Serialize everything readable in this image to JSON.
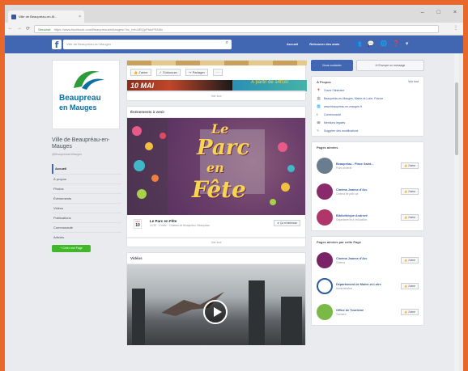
{
  "browser": {
    "tab_title": "Ville de Beaupréau-en-M...",
    "tab_close": "×",
    "url_secure": "Sécurisé",
    "url": "https://www.facebook.com/BeaupreauenMauges/?hc_ref=ARQpPtdvFR4Mx",
    "nav": [
      "←",
      "→",
      "⟳"
    ],
    "window_controls": [
      "–",
      "□",
      "×"
    ],
    "menu": "⋮"
  },
  "fb": {
    "logo": "f",
    "search_placeholder": "Ville de Beaupréau-en-Mauges",
    "nav": [
      "Accueil",
      "Retrouver des amis"
    ],
    "icons": [
      "👥",
      "💬",
      "🌐",
      "❓",
      "▾"
    ]
  },
  "left": {
    "logo_line1": "Beaupreau",
    "logo_line2": "en Mauges",
    "page_title": "Ville de Beaupréau-en-Mauges",
    "handle": "@BeaupreauenMauges",
    "nav": [
      "Accueil",
      "À propos",
      "Photos",
      "Événements",
      "Vidéos",
      "Publications",
      "Communauté",
      "Articles"
    ],
    "create_page": "+ Créer une Page"
  },
  "center": {
    "actions": [
      "👍 J'aime",
      "✓ S'abonner",
      "↪ Partager",
      "···"
    ],
    "banner_text": "10 MAI",
    "banner2_text": "À partir de 14h30",
    "see_all": "Voir tout",
    "events_header": "Événements à venir",
    "event_image_title": [
      "Le",
      "Parc",
      "en",
      "Fête"
    ],
    "event": {
      "month": "MAI",
      "day": "10",
      "name": "Le Parc en Fête",
      "details": "14:30 · 1 invité · Château de Beaupréau, Beaupréau",
      "interest_label": "★ Ça m'intéresse"
    },
    "see_all_2": "Voir tout",
    "videos_header": "Vidéos"
  },
  "right": {
    "btn_send": "Nous contacter",
    "btn_message": "✉ Envoyer un message",
    "about_header": "À Propos",
    "about_more": "Voir tout",
    "about_rows": [
      {
        "icon": "📍",
        "text": "Ouvrir l'itinéraire"
      },
      {
        "icon": "🏛",
        "text": "Beaupréau-en-Mauges, Maine-et-Loire, France"
      },
      {
        "icon": "🌐",
        "text": "www.beaupreau-en-mauges.fr"
      },
      {
        "icon": "ℹ",
        "text": "Communauté"
      },
      {
        "icon": "☎",
        "text": "Mentions légales"
      },
      {
        "icon": "✎",
        "text": "Suggérer des modifications"
      }
    ],
    "liked_header": "Pages aimées",
    "liked_pages": [
      {
        "name": "Beaupréau - Place Saint...",
        "sub": "Point d'intérêt",
        "color": "#6a7d8f",
        "like": "👍 J'aime"
      },
      {
        "name": "Cinéma Jeanne d'Arc",
        "sub": "Cinéma de plein air",
        "color": "#8a2a6a",
        "like": "👍 J'aime"
      },
      {
        "name": "Bibliothèque Andrezé",
        "sub": "Organisme lié à l'éducation",
        "color": "#b0366a",
        "like": "👍 J'aime"
      }
    ],
    "liked2_header": "Pages aimées par cette Page",
    "liked2_pages": [
      {
        "name": "Cinéma Jeanne d'Arc",
        "sub": "Cinéma",
        "color": "#7a2266",
        "like": "👍 J'aime"
      },
      {
        "name": "Département de Maine-et-Loire",
        "sub": "Administration",
        "color": "#2a5aa0",
        "like": "👍 J'aime"
      },
      {
        "name": "Office de Tourisme",
        "sub": "Tourisme",
        "color": "#7ab848",
        "like": "👍 J'aime"
      }
    ]
  }
}
